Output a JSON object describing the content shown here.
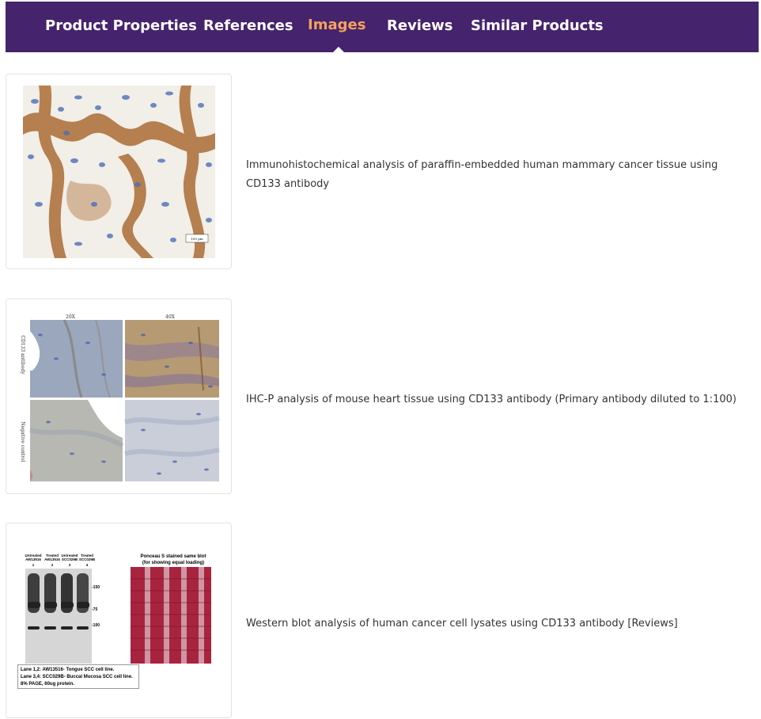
{
  "nav": {
    "tabs": [
      {
        "label": "Product Properties"
      },
      {
        "label": "References"
      },
      {
        "label": "Images",
        "active": true
      },
      {
        "label": "Reviews"
      },
      {
        "label": "Similar Products"
      }
    ],
    "background": "#45236d",
    "active_color": "#f5a25c"
  },
  "images": [
    {
      "caption": "Immunohistochemical analysis of paraffin-embedded human mammary cancer tissue using CD133 antibody",
      "scale_bar": "100 µm"
    },
    {
      "caption": "IHC-P analysis of mouse heart tissue using CD133 antibody (Primary antibody diluted to 1:100)",
      "col_labels": [
        "20X",
        "40X"
      ],
      "row_labels": [
        "CD133 antibody",
        "Negative control"
      ]
    },
    {
      "caption": "Western blot analysis of human cancer cell lysates using CD133 antibody [Reviews]",
      "lane_headers": [
        "Untreated AW13516",
        "Treated AW13516",
        "Untreated SCC029B",
        "Treated SCC029B"
      ],
      "lane_numbers": [
        "1",
        "2",
        "3",
        "4"
      ],
      "markers": [
        "-150",
        "-75",
        "-100"
      ],
      "ponceau_title": "Ponceau S stained same blot",
      "ponceau_subtitle": "(for showing equal loading)",
      "legend": [
        "Lane 1,2: AW13516- Tongue SCC cell line.",
        "Lane 3,4: SCC029B- Buccal Mucosa SCC cell line.",
        "8% PAGE, 60ug protein."
      ]
    }
  ]
}
